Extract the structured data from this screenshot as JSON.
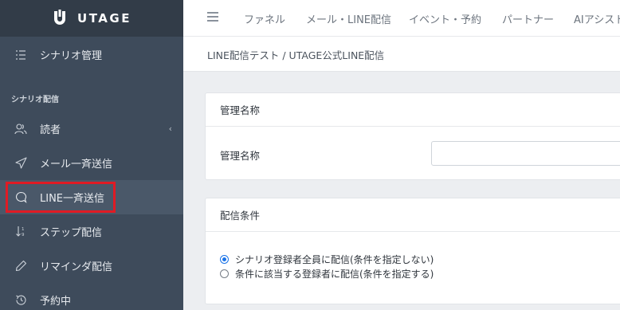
{
  "brand": {
    "name": "UTAGE"
  },
  "sidebar": {
    "section_title": "シナリオ配信",
    "items": [
      {
        "label": "シナリオ管理",
        "icon": "list-icon"
      },
      {
        "label": "読者",
        "icon": "users-icon"
      },
      {
        "label": "メール一斉送信",
        "icon": "paper-plane-icon"
      },
      {
        "label": "LINE一斉送信",
        "icon": "chat-bubble-icon"
      },
      {
        "label": "ステップ配信",
        "icon": "sort-steps-icon"
      },
      {
        "label": "リマインダ配信",
        "icon": "pencil-icon"
      },
      {
        "label": "予約中",
        "icon": "clock-history-icon"
      }
    ],
    "collapse_indicator": "‹"
  },
  "topnav": {
    "items": [
      "ファネル",
      "メール・LINE配信",
      "イベント・予約",
      "パートナー",
      "AIアシスト"
    ]
  },
  "breadcrumb": "LINE配信テスト / UTAGE公式LINE配信",
  "cards": {
    "name_card": {
      "title": "管理名称",
      "field_label": "管理名称",
      "field_value": ""
    },
    "condition_card": {
      "title": "配信条件",
      "options": [
        {
          "label": "シナリオ登録者全員に配信(条件を指定しない)",
          "checked": true
        },
        {
          "label": "条件に該当する登録者に配信(条件を指定する)",
          "checked": false
        }
      ]
    }
  },
  "colors": {
    "sidebar_bg": "#3e4b5b",
    "brand_bg": "#323c48",
    "highlight": "#e01b24",
    "radio_accent": "#1a73e8"
  }
}
